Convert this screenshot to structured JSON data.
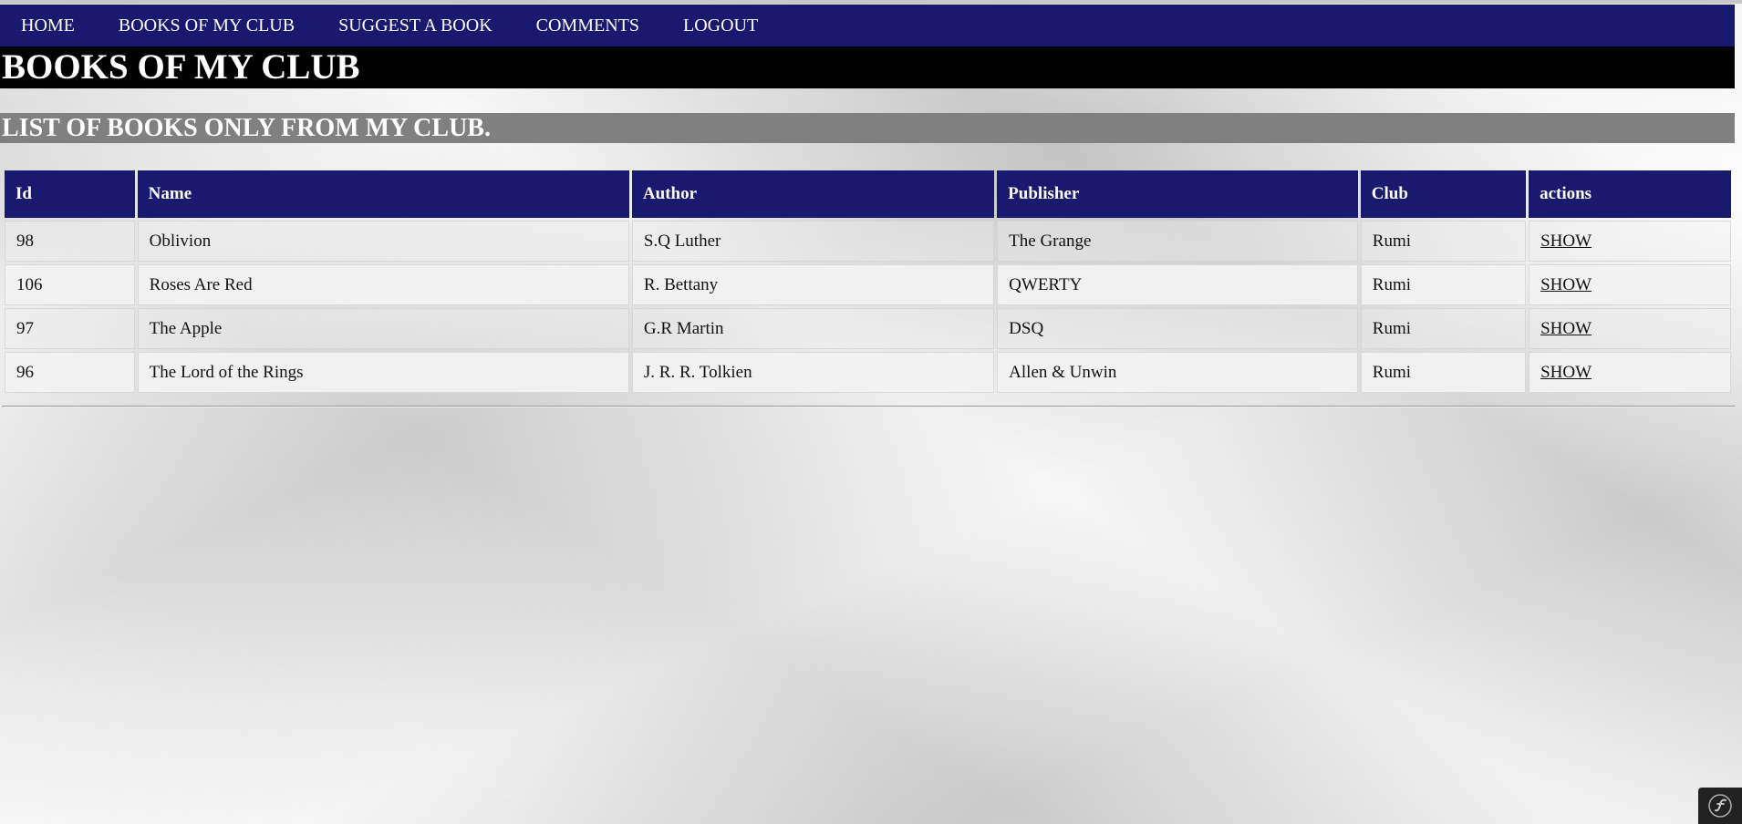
{
  "nav": {
    "items": [
      {
        "label": "HOME"
      },
      {
        "label": "BOOKS OF MY CLUB"
      },
      {
        "label": "SUGGEST A BOOK"
      },
      {
        "label": "COMMENTS"
      },
      {
        "label": "LOGOUT"
      }
    ]
  },
  "header": {
    "title": "BOOKS OF MY CLUB",
    "subtitle": "LIST OF BOOKS ONLY FROM MY CLUB."
  },
  "table": {
    "columns": [
      "Id",
      "Name",
      "Author",
      "Publisher",
      "Club",
      "actions"
    ],
    "rows": [
      {
        "id": "98",
        "name": "Oblivion",
        "author": "S.Q Luther",
        "publisher": "The Grange",
        "club": "Rumi",
        "action": "SHOW"
      },
      {
        "id": "106",
        "name": "Roses Are Red",
        "author": "R. Bettany",
        "publisher": "QWERTY",
        "club": "Rumi",
        "action": "SHOW"
      },
      {
        "id": "97",
        "name": "The Apple",
        "author": "G.R Martin",
        "publisher": "DSQ",
        "club": "Rumi",
        "action": "SHOW"
      },
      {
        "id": "96",
        "name": "The Lord of the Rings",
        "author": "J. R. R. Tolkien",
        "publisher": "Allen & Unwin",
        "club": "Rumi",
        "action": "SHOW"
      }
    ]
  },
  "debug_toolbar": {
    "icon": "symfony-logo-icon"
  },
  "colors": {
    "nav_background": "#191970",
    "title_background": "#000000",
    "subtitle_background": "#808080",
    "header_cell_background": "#191970"
  }
}
